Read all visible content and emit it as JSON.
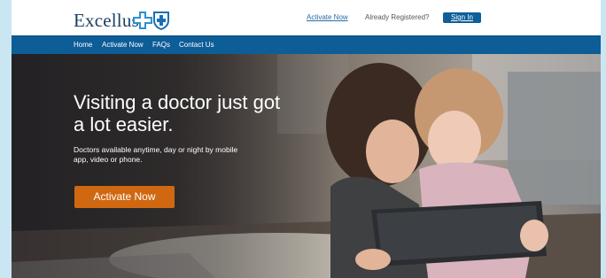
{
  "header": {
    "logo_text": "Excellus",
    "activate_link": "Activate Now",
    "registered_text": "Already Registered?",
    "sign_in": "Sign In"
  },
  "nav": {
    "items": [
      {
        "label": "Home"
      },
      {
        "label": "Activate Now"
      },
      {
        "label": "FAQs"
      },
      {
        "label": "Contact Us"
      }
    ]
  },
  "hero": {
    "headline": "Visiting a doctor just got a lot easier.",
    "subtext": "Doctors available anytime, day or night by mobile app, video or phone.",
    "cta_label": "Activate Now"
  },
  "colors": {
    "brand_blue": "#0d5d97",
    "cta_orange": "#d06812",
    "page_bg": "#c9e6f2"
  },
  "icons": [
    "blue-cross-icon",
    "blue-shield-icon"
  ]
}
